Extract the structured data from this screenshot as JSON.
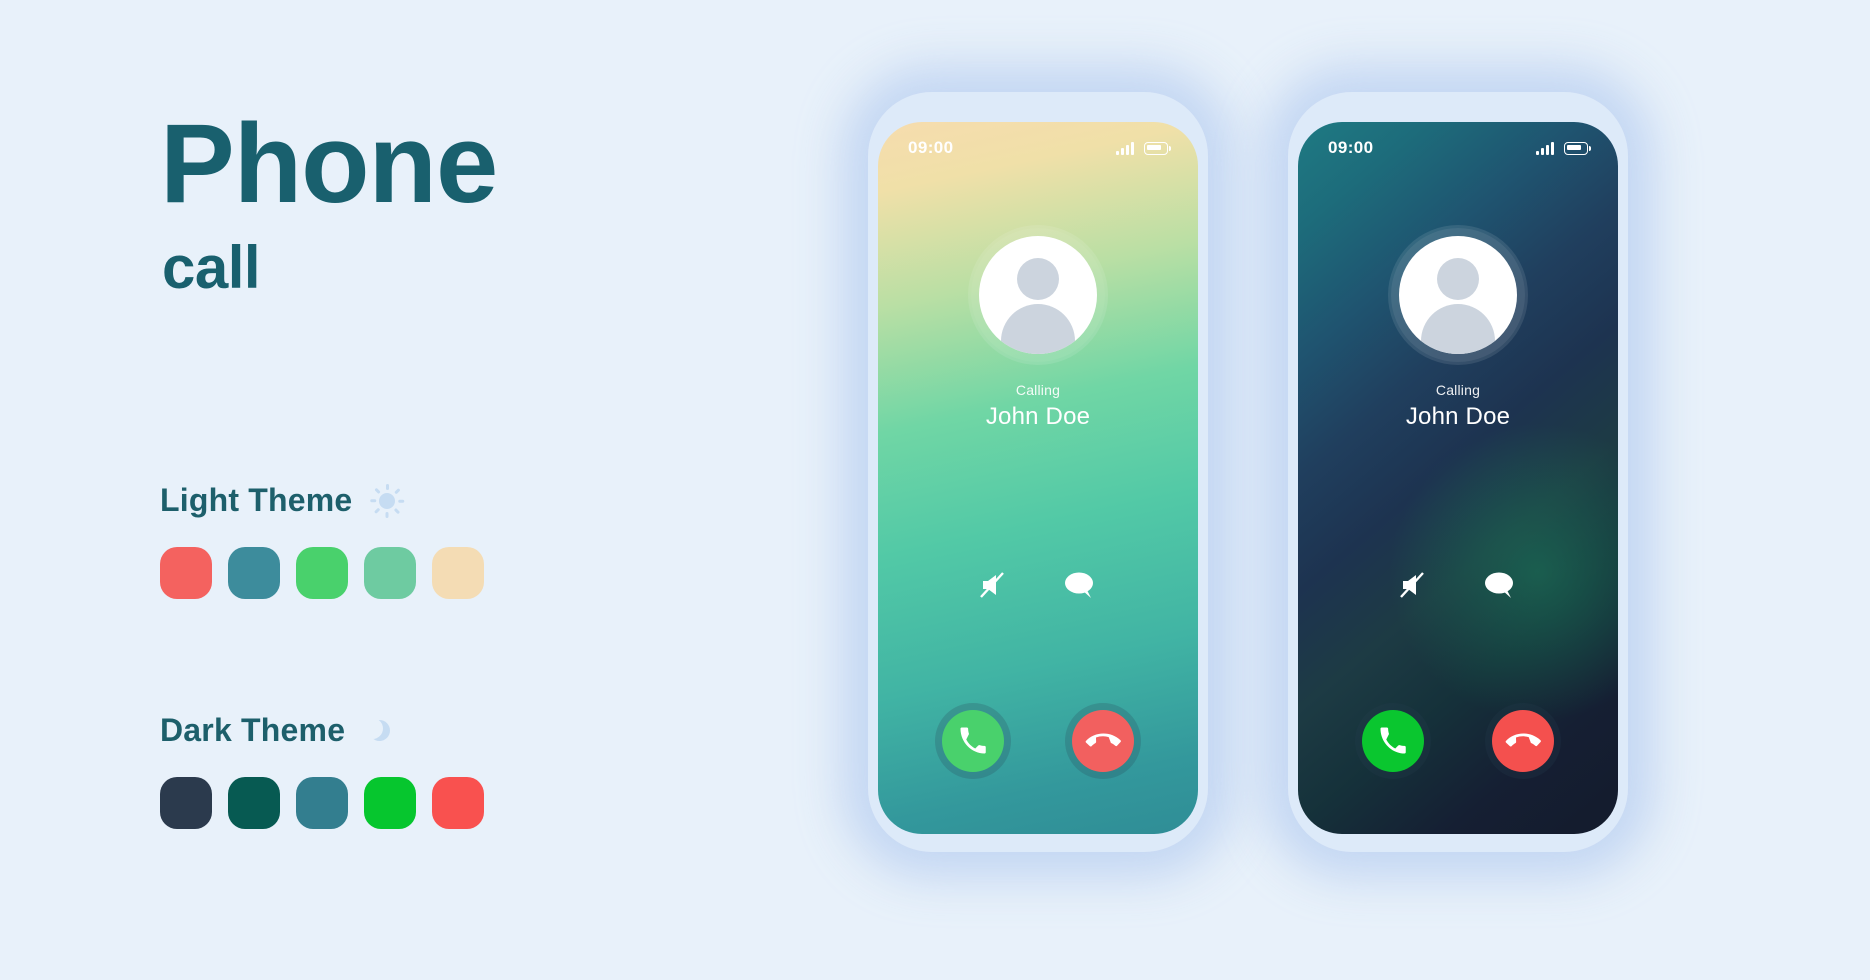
{
  "page": {
    "background_color": "#e8f1fa",
    "accent_color": "#19606e"
  },
  "title": {
    "main": "Phone",
    "sub": "call"
  },
  "themes": [
    {
      "key": "light",
      "label": "Light Theme",
      "icon": "sun-icon",
      "swatches": [
        "#f4625f",
        "#3d8c9c",
        "#49d16c",
        "#6ecba1",
        "#f4dcb4"
      ]
    },
    {
      "key": "dark",
      "label": "Dark Theme",
      "icon": "moon-icon",
      "swatches": [
        "#2b3a4d",
        "#075a52",
        "#337e8f",
        "#06c62e",
        "#f9514f"
      ]
    }
  ],
  "phones": [
    {
      "key": "light",
      "status": {
        "time": "09:00",
        "signal_icon": "signal-bars-icon",
        "battery_icon": "battery-icon"
      },
      "call": {
        "avatar_icon": "user-avatar-icon",
        "status_label": "Calling",
        "caller_name": "John Doe",
        "mute_icon": "mute-speaker-icon",
        "message_icon": "speech-bubble-icon",
        "accept_icon": "phone-handset-icon",
        "decline_icon": "phone-handset-decline-icon"
      }
    },
    {
      "key": "dark",
      "status": {
        "time": "09:00",
        "signal_icon": "signal-bars-icon",
        "battery_icon": "battery-icon"
      },
      "call": {
        "avatar_icon": "user-avatar-icon",
        "status_label": "Calling",
        "caller_name": "John Doe",
        "mute_icon": "mute-speaker-icon",
        "message_icon": "speech-bubble-icon",
        "accept_icon": "phone-handset-icon",
        "decline_icon": "phone-handset-decline-icon"
      }
    }
  ]
}
